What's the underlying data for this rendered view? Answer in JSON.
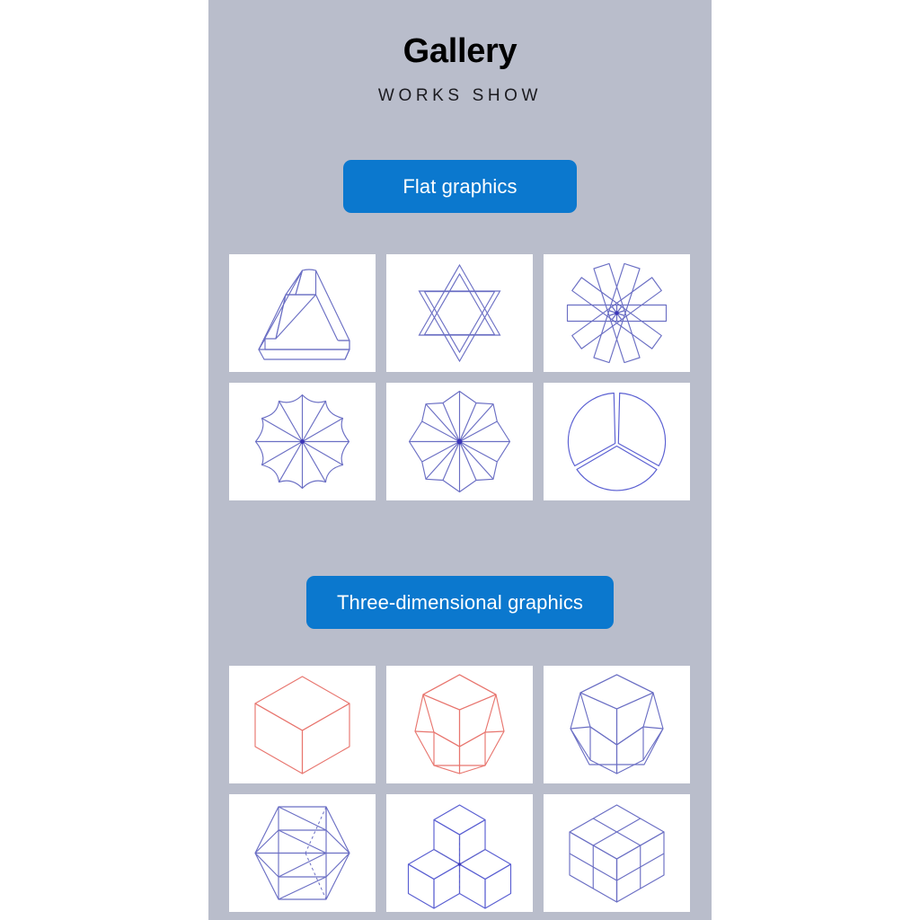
{
  "page": {
    "background_color": "#ffffff",
    "panel_color": "#b9bdcb",
    "accent_color": "#0b78ce"
  },
  "header": {
    "title": "Gallery",
    "subtitle": "WORKS SHOW"
  },
  "sections": [
    {
      "id": "flat",
      "button_label": "Flat graphics",
      "tiles": [
        {
          "name": "penrose-triangle",
          "stroke_color": "#6b6fc4"
        },
        {
          "name": "six-pointed-star",
          "stroke_color": "#6b6fc4"
        },
        {
          "name": "pinwheel-rectangles",
          "stroke_color": "#6b6fc4"
        },
        {
          "name": "scalloped-radial-fan",
          "stroke_color": "#6b6fc4"
        },
        {
          "name": "radial-star-rosette",
          "stroke_color": "#6b6fc4"
        },
        {
          "name": "split-circle-three-sectors",
          "stroke_color": "#5a5fd2"
        }
      ]
    },
    {
      "id": "three-dimensional",
      "button_label": "Three-dimensional graphics",
      "tiles": [
        {
          "name": "isometric-cube",
          "stroke_color": "#e8766f"
        },
        {
          "name": "rhombic-polyhedron",
          "stroke_color": "#e8766f"
        },
        {
          "name": "rhombic-polyhedron-blue",
          "stroke_color": "#6b6fc4"
        },
        {
          "name": "icosahedron-wireframe",
          "stroke_color": "#6b6fc4"
        },
        {
          "name": "three-cube-cluster",
          "stroke_color": "#5a5fd2"
        },
        {
          "name": "subdivided-cube",
          "stroke_color": "#6b6fc4"
        }
      ]
    }
  ]
}
